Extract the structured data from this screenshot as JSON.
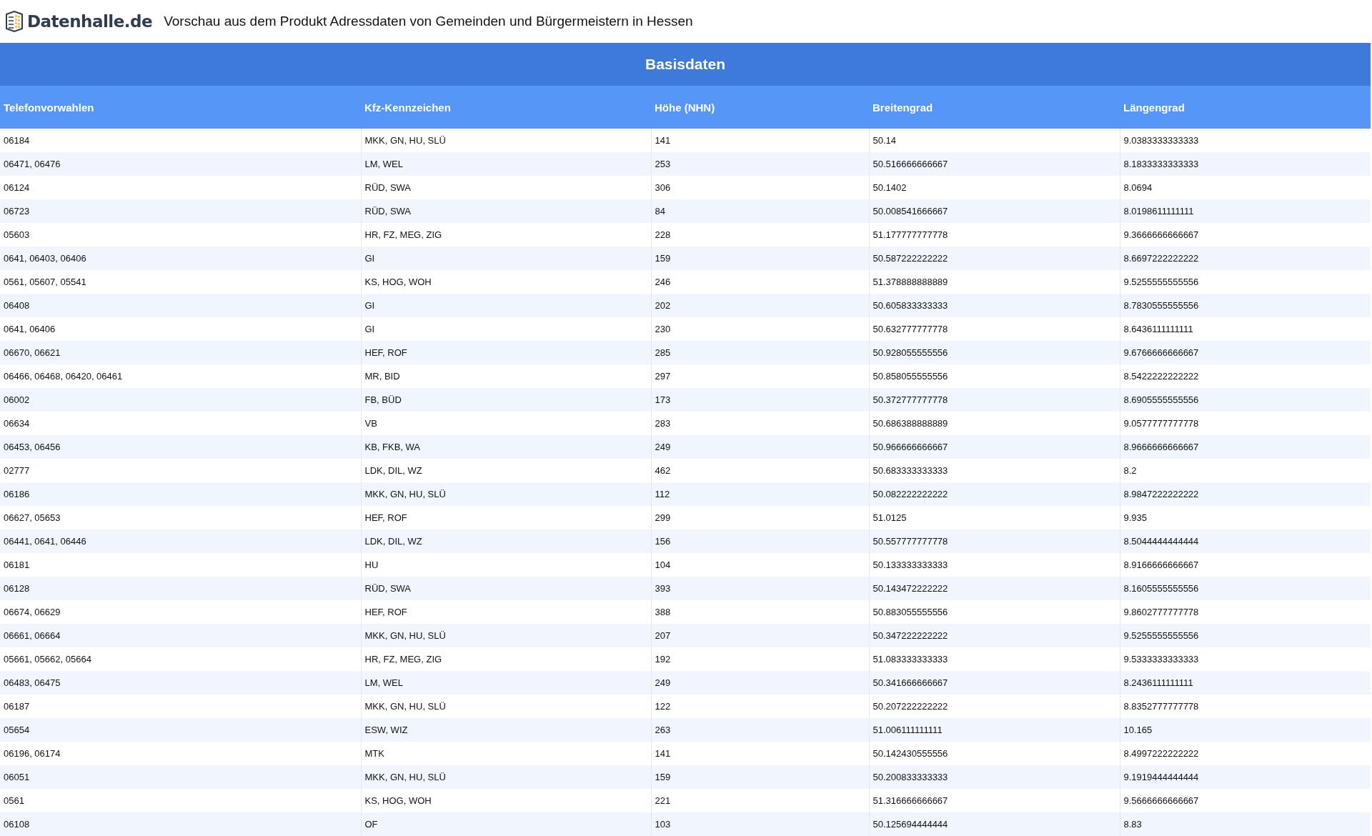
{
  "header": {
    "logo_text": "Datenhalle.de",
    "title": "Vorschau aus dem Produkt Adressdaten von Gemeinden und Bürgermeistern in Hessen"
  },
  "section": {
    "title": "Basisdaten"
  },
  "table": {
    "columns": [
      "Telefonvorwahlen",
      "Kfz-Kennzeichen",
      "Höhe (NHN)",
      "Breitengrad",
      "Längengrad"
    ],
    "rows": [
      [
        "06184",
        "MKK, GN, HU, SLÜ",
        "141",
        "50.14",
        "9.0383333333333"
      ],
      [
        "06471, 06476",
        "LM, WEL",
        "253",
        "50.516666666667",
        "8.1833333333333"
      ],
      [
        "06124",
        "RÜD, SWA",
        "306",
        "50.1402",
        "8.0694"
      ],
      [
        "06723",
        "RÜD, SWA",
        "84",
        "50.008541666667",
        "8.0198611111111"
      ],
      [
        "05603",
        "HR, FZ, MEG, ZIG",
        "228",
        "51.177777777778",
        "9.3666666666667"
      ],
      [
        "0641, 06403, 06406",
        "GI",
        "159",
        "50.587222222222",
        "8.6697222222222"
      ],
      [
        "0561, 05607, 05541",
        "KS, HOG, WOH",
        "246",
        "51.378888888889",
        "9.5255555555556"
      ],
      [
        "06408",
        "GI",
        "202",
        "50.605833333333",
        "8.7830555555556"
      ],
      [
        "0641, 06406",
        "GI",
        "230",
        "50.632777777778",
        "8.6436111111111"
      ],
      [
        "06670, 06621",
        "HEF, ROF",
        "285",
        "50.928055555556",
        "9.6766666666667"
      ],
      [
        "06466, 06468, 06420, 06461",
        "MR, BID",
        "297",
        "50.858055555556",
        "8.5422222222222"
      ],
      [
        "06002",
        "FB, BÜD",
        "173",
        "50.372777777778",
        "8.6905555555556"
      ],
      [
        "06634",
        "VB",
        "283",
        "50.686388888889",
        "9.0577777777778"
      ],
      [
        "06453, 06456",
        "KB, FKB, WA",
        "249",
        "50.966666666667",
        "8.9666666666667"
      ],
      [
        "02777",
        "LDK, DIL, WZ",
        "462",
        "50.683333333333",
        "8.2"
      ],
      [
        "06186",
        "MKK, GN, HU, SLÜ",
        "112",
        "50.082222222222",
        "8.9847222222222"
      ],
      [
        "06627, 05653",
        "HEF, ROF",
        "299",
        "51.0125",
        "9.935"
      ],
      [
        "06441, 0641, 06446",
        "LDK, DIL, WZ",
        "156",
        "50.557777777778",
        "8.5044444444444"
      ],
      [
        "06181",
        "HU",
        "104",
        "50.133333333333",
        "8.9166666666667"
      ],
      [
        "06128",
        "RÜD, SWA",
        "393",
        "50.143472222222",
        "8.1605555555556"
      ],
      [
        "06674, 06629",
        "HEF, ROF",
        "388",
        "50.883055555556",
        "9.8602777777778"
      ],
      [
        "06661, 06664",
        "MKK, GN, HU, SLÜ",
        "207",
        "50.347222222222",
        "9.5255555555556"
      ],
      [
        "05661, 05662, 05664",
        "HR, FZ, MEG, ZIG",
        "192",
        "51.083333333333",
        "9.5333333333333"
      ],
      [
        "06483, 06475",
        "LM, WEL",
        "249",
        "50.341666666667",
        "8.2436111111111"
      ],
      [
        "06187",
        "MKK, GN, HU, SLÜ",
        "122",
        "50.207222222222",
        "8.8352777777778"
      ],
      [
        "05654",
        "ESW, WIZ",
        "263",
        "51.006111111111",
        "10.165"
      ],
      [
        "06196, 06174",
        "MTK",
        "141",
        "50.142430555556",
        "8.4997222222222"
      ],
      [
        "06051",
        "MKK, GN, HU, SLÜ",
        "159",
        "50.200833333333",
        "9.1919444444444"
      ],
      [
        "0561",
        "KS, HOG, WOH",
        "221",
        "51.316666666667",
        "9.5666666666667"
      ],
      [
        "06108",
        "OF",
        "103",
        "50.125694444444",
        "8.83"
      ]
    ]
  }
}
